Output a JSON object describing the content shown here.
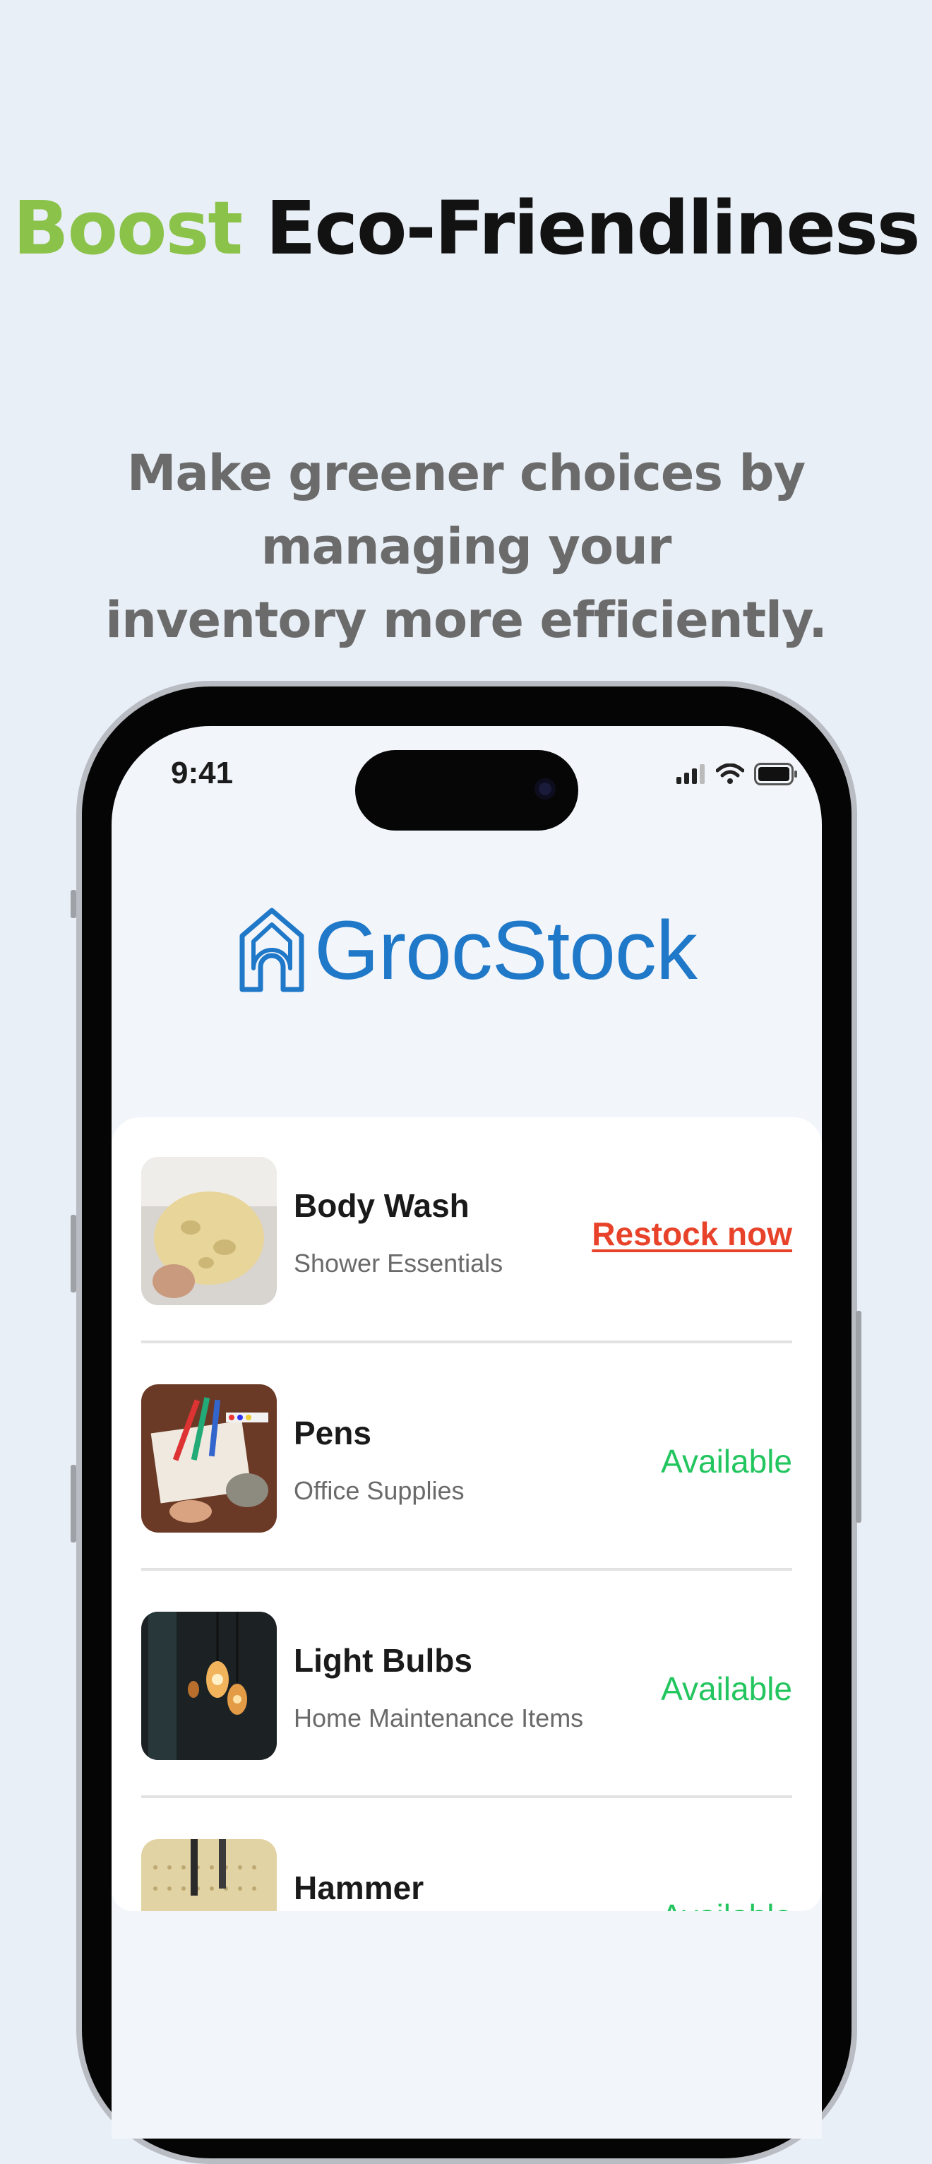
{
  "headline": {
    "accent": "Boost",
    "rest": " Eco-Friendliness"
  },
  "subline": {
    "line1": "Make greener choices by managing your",
    "line2": "inventory more efficiently."
  },
  "status_bar": {
    "time": "9:41"
  },
  "app": {
    "brand": "GrocStock",
    "brand_color": "#1f78c8"
  },
  "items": [
    {
      "name": "Body Wash",
      "category": "Shower Essentials",
      "status": "Restock now",
      "status_type": "restock",
      "thumb_icon": "sponge-photo"
    },
    {
      "name": "Pens",
      "category": "Office Supplies",
      "status": "Available",
      "status_type": "available",
      "thumb_icon": "pens-photo"
    },
    {
      "name": "Light Bulbs",
      "category": "Home Maintenance Items",
      "status": "Available",
      "status_type": "available",
      "thumb_icon": "bulbs-photo"
    },
    {
      "name": "Hammer",
      "category": "",
      "status": "Available",
      "status_type": "available",
      "thumb_icon": "hammer-photo"
    }
  ],
  "colors": {
    "accent_green": "#8bc34a",
    "restock_red": "#e8432a",
    "available_green": "#22c55e",
    "background": "#e9eff7"
  }
}
